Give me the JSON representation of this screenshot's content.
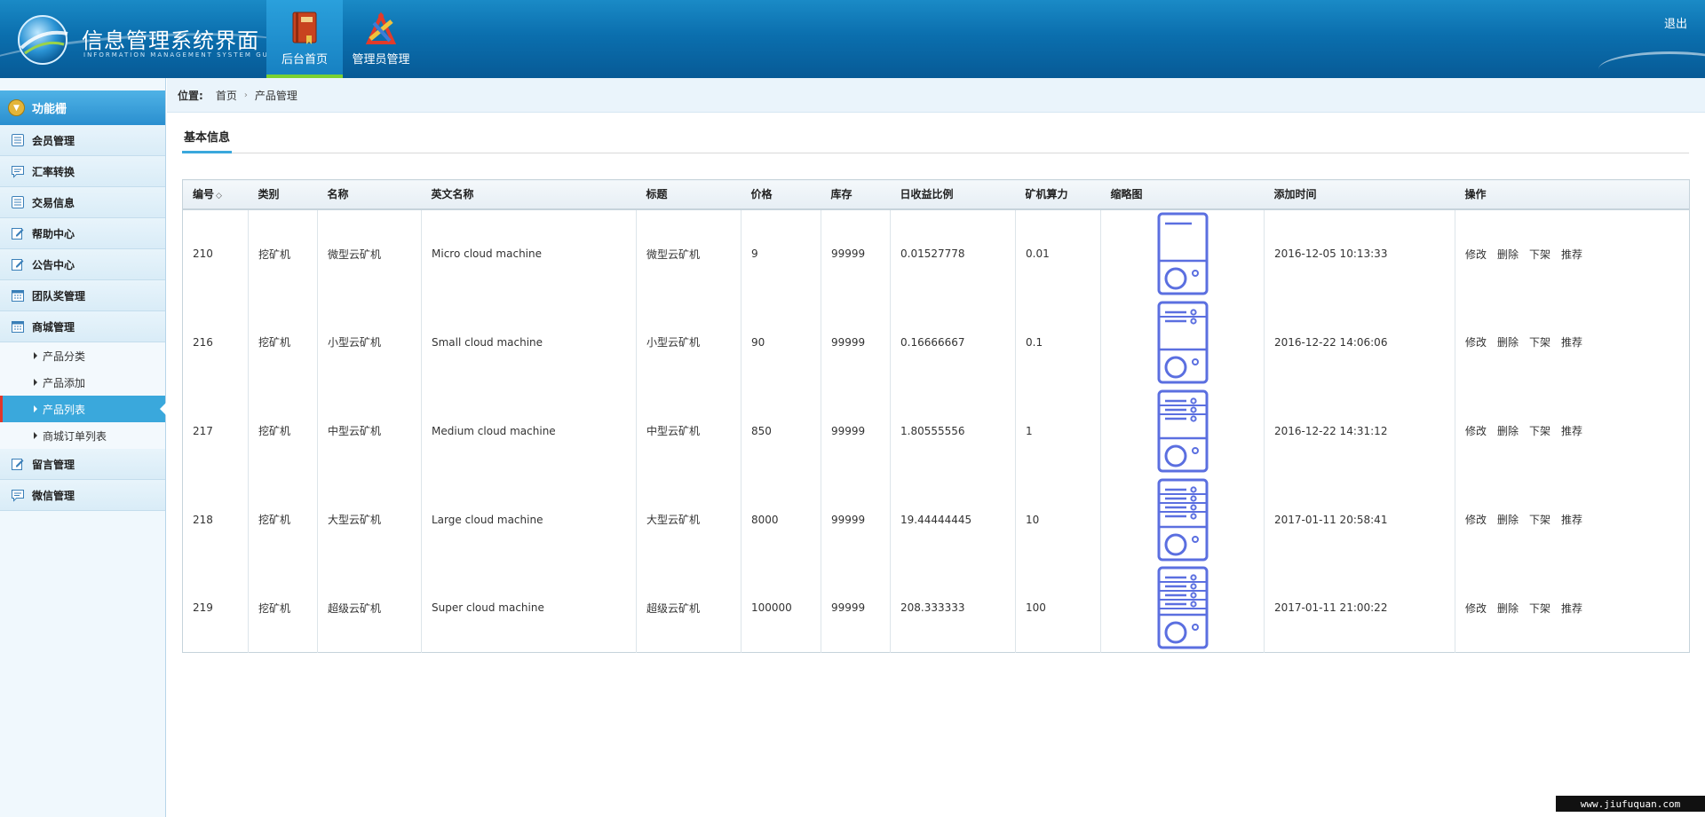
{
  "header": {
    "title": "信息管理系统界面",
    "subtitle": "INFORMATION MANAGEMENT SYSTEM GUI",
    "tabs": [
      {
        "label": "后台首页",
        "icon": "book-icon",
        "active": true
      },
      {
        "label": "管理员管理",
        "icon": "tools-icon",
        "active": false
      }
    ],
    "logout": "退出"
  },
  "sidebar": {
    "heading": "功能栅",
    "items": [
      {
        "label": "会员管理",
        "icon": "list-icon"
      },
      {
        "label": "汇率转换",
        "icon": "chat-icon"
      },
      {
        "label": "交易信息",
        "icon": "list-icon"
      },
      {
        "label": "帮助中心",
        "icon": "edit-icon"
      },
      {
        "label": "公告中心",
        "icon": "edit-icon"
      },
      {
        "label": "团队奖管理",
        "icon": "calendar-icon"
      },
      {
        "label": "商城管理",
        "icon": "calendar-icon"
      }
    ],
    "sub_items": [
      {
        "label": "产品分类",
        "active": false
      },
      {
        "label": "产品添加",
        "active": false
      },
      {
        "label": "产品列表",
        "active": true
      },
      {
        "label": "商城订单列表",
        "active": false
      }
    ],
    "items_after": [
      {
        "label": "留言管理",
        "icon": "edit-icon"
      },
      {
        "label": "微信管理",
        "icon": "chat-icon"
      }
    ]
  },
  "breadcrumb": {
    "label": "位置:",
    "items": [
      "首页",
      "产品管理"
    ],
    "separator": "›"
  },
  "section_tab": "基本信息",
  "table": {
    "columns": [
      "编号",
      "类别",
      "名称",
      "英文名称",
      "标题",
      "价格",
      "库存",
      "日收益比例",
      "矿机算力",
      "缩略图",
      "添加时间",
      "操作"
    ],
    "sort_glyph": "◇",
    "actions": [
      "修改",
      "删除",
      "下架",
      "推荐"
    ],
    "rows": [
      {
        "id": "210",
        "category": "挖矿机",
        "name": "微型云矿机",
        "en_name": "Micro cloud machine",
        "title": "微型云矿机",
        "price": "9",
        "stock": "99999",
        "daily_ratio": "0.01527778",
        "hashrate": "0.01",
        "thumb_slots": 1,
        "added": "2016-12-05 10:13:33"
      },
      {
        "id": "216",
        "category": "挖矿机",
        "name": "小型云矿机",
        "en_name": "Small cloud machine",
        "title": "小型云矿机",
        "price": "90",
        "stock": "99999",
        "daily_ratio": "0.16666667",
        "hashrate": "0.1",
        "thumb_slots": 2,
        "added": "2016-12-22 14:06:06"
      },
      {
        "id": "217",
        "category": "挖矿机",
        "name": "中型云矿机",
        "en_name": "Medium cloud machine",
        "title": "中型云矿机",
        "price": "850",
        "stock": "99999",
        "daily_ratio": "1.80555556",
        "hashrate": "1",
        "thumb_slots": 3,
        "added": "2016-12-22 14:31:12"
      },
      {
        "id": "218",
        "category": "挖矿机",
        "name": "大型云矿机",
        "en_name": "Large cloud machine",
        "title": "大型云矿机",
        "price": "8000",
        "stock": "99999",
        "daily_ratio": "19.44444445",
        "hashrate": "10",
        "thumb_slots": 4,
        "added": "2017-01-11 20:58:41"
      },
      {
        "id": "219",
        "category": "挖矿机",
        "name": "超级云矿机",
        "en_name": "Super cloud machine",
        "title": "超级云矿机",
        "price": "100000",
        "stock": "99999",
        "daily_ratio": "208.333333",
        "hashrate": "100",
        "thumb_slots": 5,
        "added": "2017-01-11 21:00:22"
      }
    ]
  },
  "watermark": "www.jiufuquan.com",
  "colors": {
    "header": "#0b6fae",
    "accent": "#3aa8dc",
    "active_tab_underline": "#7ad131",
    "thumbnail_stroke": "#5b6fe0"
  }
}
